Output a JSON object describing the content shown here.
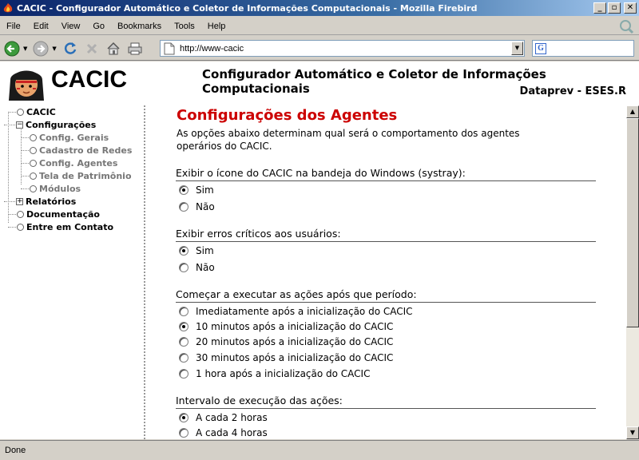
{
  "window": {
    "title": "CACIC - Configurador Automático e Coletor de Informações Computacionais - Mozilla Firebird",
    "buttons": {
      "minimize": "_",
      "maximize": "▫",
      "close": "✕"
    }
  },
  "menu": [
    "File",
    "Edit",
    "View",
    "Go",
    "Bookmarks",
    "Tools",
    "Help"
  ],
  "toolbar": {
    "url": "http://www-cacic",
    "icons": [
      "back-icon",
      "forward-icon",
      "reload-icon",
      "stop-icon",
      "home-icon",
      "print-icon"
    ],
    "search_engine_icon": "G"
  },
  "header": {
    "logo_text": "CACIC",
    "system_title": "Configurador Automático e Coletor de Informações Computacionais",
    "subtitle": "Dataprev - ESES.R"
  },
  "sidebar": {
    "items": [
      {
        "label": "CACIC",
        "level": 0,
        "type": "node"
      },
      {
        "label": "Configurações",
        "level": 0,
        "type": "expanded"
      },
      {
        "label": "Config. Gerais",
        "level": 1,
        "type": "node"
      },
      {
        "label": "Cadastro de Redes",
        "level": 1,
        "type": "node"
      },
      {
        "label": "Config. Agentes",
        "level": 1,
        "type": "node"
      },
      {
        "label": "Tela de Patrimônio",
        "level": 1,
        "type": "node"
      },
      {
        "label": "Módulos",
        "level": 1,
        "type": "node"
      },
      {
        "label": "Relatórios",
        "level": 0,
        "type": "collapsed"
      },
      {
        "label": "Documentação",
        "level": 0,
        "type": "node"
      },
      {
        "label": "Entre em Contato",
        "level": 0,
        "type": "node"
      }
    ]
  },
  "main": {
    "heading": "Configurações dos Agentes",
    "intro": "As opções abaixo determinam qual será o comportamento dos agentes operários do CACIC.",
    "sections": [
      {
        "title": "Exibir o ícone do CACIC na bandeja do Windows (systray):",
        "options": [
          {
            "label": "Sim",
            "selected": true
          },
          {
            "label": "Não",
            "selected": false
          }
        ]
      },
      {
        "title": "Exibir erros críticos aos usuários:",
        "options": [
          {
            "label": "Sim",
            "selected": true
          },
          {
            "label": "Não",
            "selected": false
          }
        ]
      },
      {
        "title": "Começar a executar as ações após que período:",
        "options": [
          {
            "label": "Imediatamente após a inicialização do CACIC",
            "selected": false
          },
          {
            "label": "10 minutos após a inicialização do CACIC",
            "selected": true
          },
          {
            "label": "20 minutos após a inicialização do CACIC",
            "selected": false
          },
          {
            "label": "30 minutos após a inicialização do CACIC",
            "selected": false
          },
          {
            "label": "1 hora após a inicialização do CACIC",
            "selected": false
          }
        ]
      },
      {
        "title": "Intervalo de execução das ações:",
        "options": [
          {
            "label": "A cada 2 horas",
            "selected": true
          },
          {
            "label": "A cada 4 horas",
            "selected": false
          }
        ]
      }
    ]
  },
  "status": {
    "text": "Done"
  },
  "colors": {
    "heading": "#cc0000",
    "titlebar": "#0a246a"
  }
}
